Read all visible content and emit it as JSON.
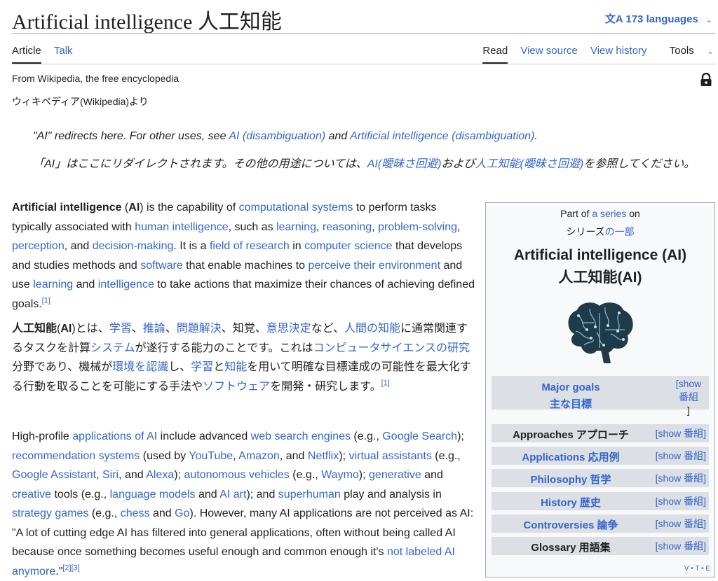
{
  "header": {
    "title": "Artificial intelligence  人工知能",
    "languages_label": "173 languages"
  },
  "tabs": {
    "left": [
      "Article",
      "Talk"
    ],
    "right": [
      "Read",
      "View source",
      "View history",
      "Tools"
    ]
  },
  "tagline": "From Wikipedia, the free encyclopedia",
  "tagline_ja": "ウィキペディア(Wikipedia)より",
  "hatnote": {
    "en_pre": "\"AI\" redirects here. For other uses, see ",
    "en_link1": "AI (disambiguation)",
    "en_mid": " and ",
    "en_link2": "Artificial intelligence (disambiguation)",
    "en_post": ".",
    "ja_pre": "「AI」はここにリダイレクトされます。その他の用途については、",
    "ja_link1": "AI(曖昧さ回避)",
    "ja_mid": "および",
    "ja_link2": "人工知能(曖昧さ回避)",
    "ja_post": "を参照してください。"
  },
  "p1": [
    {
      "t": "Artificial intelligence",
      "b": true
    },
    {
      "t": " ("
    },
    {
      "t": "AI",
      "b": true
    },
    {
      "t": ") is the capability of "
    },
    {
      "t": "computational systems",
      "l": true
    },
    {
      "t": " to perform tasks typically associated with "
    },
    {
      "t": "human intelligence",
      "l": true
    },
    {
      "t": ", such as "
    },
    {
      "t": "learning",
      "l": true
    },
    {
      "t": ", "
    },
    {
      "t": "reasoning",
      "l": true
    },
    {
      "t": ", "
    },
    {
      "t": "problem-solving",
      "l": true
    },
    {
      "t": ", "
    },
    {
      "t": "perception",
      "l": true
    },
    {
      "t": ", and "
    },
    {
      "t": "decision-making",
      "l": true
    },
    {
      "t": ". It is a "
    },
    {
      "t": "field of research",
      "l": true
    },
    {
      "t": " in "
    },
    {
      "t": "computer science",
      "l": true
    },
    {
      "t": " that develops and studies methods and "
    },
    {
      "t": "software",
      "l": true
    },
    {
      "t": " that enable machines to "
    },
    {
      "t": "perceive their environment",
      "l": true
    },
    {
      "t": " and use "
    },
    {
      "t": "learning",
      "l": true
    },
    {
      "t": " and "
    },
    {
      "t": "intelligence",
      "l": true
    },
    {
      "t": " to take actions that maximize their chances of achieving defined goals."
    },
    {
      "t": "[1]",
      "s": true
    }
  ],
  "p2": [
    {
      "t": "人工知能",
      "b": true
    },
    {
      "t": "("
    },
    {
      "t": "AI",
      "b": true
    },
    {
      "t": ")とは、"
    },
    {
      "t": "学習",
      "l": true
    },
    {
      "t": "、"
    },
    {
      "t": "推論",
      "l": true
    },
    {
      "t": "、"
    },
    {
      "t": "問題解決",
      "l": true
    },
    {
      "t": "、知覚、"
    },
    {
      "t": "意思決定",
      "l": true
    },
    {
      "t": "など、"
    },
    {
      "t": "人間の知能",
      "l": true
    },
    {
      "t": "に通常関連するタスクを計算"
    },
    {
      "t": "システム",
      "l": true
    },
    {
      "t": "が遂行する能力のことです。これは"
    },
    {
      "t": "コンピュータサイエンスの研究",
      "l": true
    },
    {
      "t": "分野であり、機械が"
    },
    {
      "t": "環境を認識",
      "l": true
    },
    {
      "t": "し、"
    },
    {
      "t": "学習",
      "l": true
    },
    {
      "t": "と"
    },
    {
      "t": "知能",
      "l": true
    },
    {
      "t": "を用いて明確な目標達成の可能性を最大化する行動を取ることを可能にする手法や"
    },
    {
      "t": "ソフトウェア",
      "l": true
    },
    {
      "t": "を開発・研究します。"
    },
    {
      "t": "[1]",
      "s": true
    }
  ],
  "p3": [
    {
      "t": "High-profile "
    },
    {
      "t": "applications of AI",
      "l": true
    },
    {
      "t": " include advanced "
    },
    {
      "t": "web search engines",
      "l": true
    },
    {
      "t": " (e.g., "
    },
    {
      "t": "Google Search",
      "l": true
    },
    {
      "t": "); "
    },
    {
      "t": "recommendation systems",
      "l": true
    },
    {
      "t": " (used by "
    },
    {
      "t": "YouTube",
      "l": true
    },
    {
      "t": ", "
    },
    {
      "t": "Amazon",
      "l": true
    },
    {
      "t": ", and "
    },
    {
      "t": "Netflix",
      "l": true
    },
    {
      "t": "); "
    },
    {
      "t": "virtual assistants",
      "l": true
    },
    {
      "t": " (e.g., "
    },
    {
      "t": "Google Assistant",
      "l": true
    },
    {
      "t": ", "
    },
    {
      "t": "Siri",
      "l": true
    },
    {
      "t": ", and "
    },
    {
      "t": "Alexa",
      "l": true
    },
    {
      "t": "); "
    },
    {
      "t": "autonomous vehicles",
      "l": true
    },
    {
      "t": " (e.g., "
    },
    {
      "t": "Waymo",
      "l": true
    },
    {
      "t": "); "
    },
    {
      "t": "generative",
      "l": true
    },
    {
      "t": " and "
    },
    {
      "t": "creative",
      "l": true
    },
    {
      "t": " tools (e.g., "
    },
    {
      "t": "language models",
      "l": true
    },
    {
      "t": " and "
    },
    {
      "t": "AI art",
      "l": true
    },
    {
      "t": "); and "
    },
    {
      "t": "superhuman",
      "l": true
    },
    {
      "t": " play and analysis in "
    },
    {
      "t": "strategy games",
      "l": true
    },
    {
      "t": " (e.g., "
    },
    {
      "t": "chess",
      "l": true
    },
    {
      "t": " and "
    },
    {
      "t": "Go",
      "l": true
    },
    {
      "t": "). However, many AI applications are not perceived as AI: \"A lot of cutting edge AI has filtered into general applications, often without being called AI because once something becomes useful enough and common enough it's "
    },
    {
      "t": "not labeled AI anymore",
      "l": true
    },
    {
      "t": ".\""
    },
    {
      "t": "[2]",
      "s": true
    },
    {
      "t": "[3]",
      "s": true
    }
  ],
  "infobox": {
    "part_pre": "Part of ",
    "part_link": "a series",
    "part_post": " on",
    "part_ja_pre": "シリーズ",
    "part_ja_link": "の一部",
    "title": "Artificial intelligence (AI)",
    "title_ja": "人工知能(AI)",
    "major": "Major goals",
    "major_ja": "主な目標",
    "toggle_open": "[show",
    "toggle_ja": "番組",
    "toggle_close": "]",
    "rows": [
      {
        "label": "Approaches  アプローチ",
        "toggle": "[show  番組]",
        "style": "black"
      },
      {
        "label": "Applications  応用例",
        "toggle": "[show  番組]",
        "style": "blue"
      },
      {
        "label": "Philosophy  哲学",
        "toggle": "[show  番組]",
        "style": "blue"
      },
      {
        "label": "History  歴史",
        "toggle": "[show  番組]",
        "style": "blue"
      },
      {
        "label": "Controversies  論争",
        "toggle": "[show  番組]",
        "style": "blue"
      },
      {
        "label": "Glossary  用語集",
        "toggle": "[show  番組]",
        "style": "black"
      }
    ],
    "vte": "V • T • E"
  },
  "colors": {
    "link": "#3366cc",
    "text": "#202122",
    "infobox_bg": "#f8f9fa",
    "row_bg": "#dcdfe3"
  }
}
